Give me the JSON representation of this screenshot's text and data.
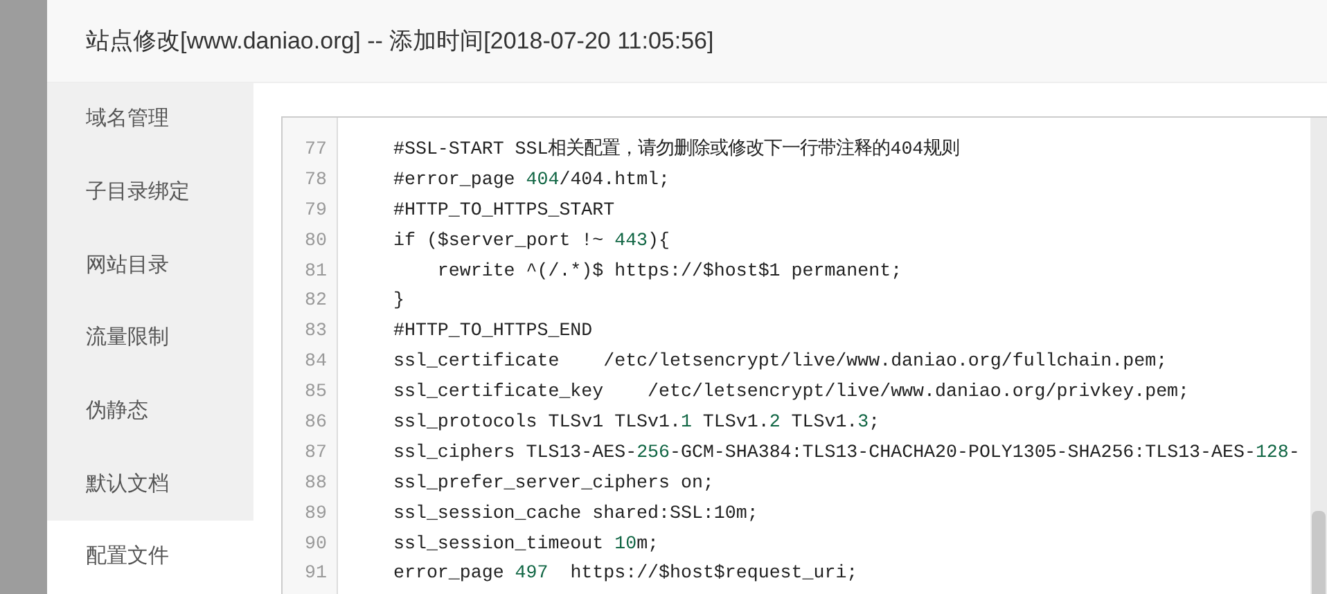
{
  "dialog": {
    "title": "站点修改[www.daniao.org] -- 添加时间[2018-07-20 11:05:56]"
  },
  "sidebar": {
    "items": [
      {
        "label": "域名管理",
        "selected": false
      },
      {
        "label": "子目录绑定",
        "selected": false
      },
      {
        "label": "网站目录",
        "selected": false
      },
      {
        "label": "流量限制",
        "selected": false
      },
      {
        "label": "伪静态",
        "selected": false
      },
      {
        "label": "默认文档",
        "selected": false
      },
      {
        "label": "配置文件",
        "selected": true
      }
    ]
  },
  "editor": {
    "lines": [
      {
        "number": "77",
        "segments": [
          {
            "kind": "plain",
            "text": "#SSL-START SSL相关配置，请勿删除或修改下一行带注释的404规则"
          }
        ]
      },
      {
        "number": "78",
        "segments": [
          {
            "kind": "plain",
            "text": "#error_page "
          },
          {
            "kind": "number",
            "text": "404"
          },
          {
            "kind": "plain",
            "text": "/404.html;"
          }
        ]
      },
      {
        "number": "79",
        "segments": [
          {
            "kind": "plain",
            "text": "#HTTP_TO_HTTPS_START"
          }
        ]
      },
      {
        "number": "80",
        "segments": [
          {
            "kind": "plain",
            "text": "if ($server_port !~ "
          },
          {
            "kind": "number",
            "text": "443"
          },
          {
            "kind": "plain",
            "text": "){"
          }
        ]
      },
      {
        "number": "81",
        "segments": [
          {
            "kind": "plain",
            "text": "    rewrite ^(/.*)$ https://$host$1 permanent;"
          }
        ]
      },
      {
        "number": "82",
        "segments": [
          {
            "kind": "plain",
            "text": "}"
          }
        ]
      },
      {
        "number": "83",
        "segments": [
          {
            "kind": "plain",
            "text": "#HTTP_TO_HTTPS_END"
          }
        ]
      },
      {
        "number": "84",
        "segments": [
          {
            "kind": "plain",
            "text": "ssl_certificate    /etc/letsencrypt/live/www.daniao.org/fullchain.pem;"
          }
        ]
      },
      {
        "number": "85",
        "segments": [
          {
            "kind": "plain",
            "text": "ssl_certificate_key    /etc/letsencrypt/live/www.daniao.org/privkey.pem;"
          }
        ]
      },
      {
        "number": "86",
        "segments": [
          {
            "kind": "plain",
            "text": "ssl_protocols TLSv1 TLSv1."
          },
          {
            "kind": "number",
            "text": "1"
          },
          {
            "kind": "plain",
            "text": " TLSv1."
          },
          {
            "kind": "number",
            "text": "2"
          },
          {
            "kind": "plain",
            "text": " TLSv1."
          },
          {
            "kind": "number",
            "text": "3"
          },
          {
            "kind": "plain",
            "text": ";"
          }
        ]
      },
      {
        "number": "87",
        "segments": [
          {
            "kind": "plain",
            "text": "ssl_ciphers TLS13-AES-"
          },
          {
            "kind": "number",
            "text": "256"
          },
          {
            "kind": "plain",
            "text": "-GCM-SHA384:TLS13-CHACHA20-POLY1305-SHA256:TLS13-AES-"
          },
          {
            "kind": "number",
            "text": "128"
          },
          {
            "kind": "plain",
            "text": "-"
          }
        ]
      },
      {
        "number": "88",
        "segments": [
          {
            "kind": "plain",
            "text": "ssl_prefer_server_ciphers on;"
          }
        ]
      },
      {
        "number": "89",
        "segments": [
          {
            "kind": "plain",
            "text": "ssl_session_cache shared:SSL:10m;"
          }
        ]
      },
      {
        "number": "90",
        "segments": [
          {
            "kind": "plain",
            "text": "ssl_session_timeout "
          },
          {
            "kind": "number",
            "text": "10"
          },
          {
            "kind": "plain",
            "text": "m;"
          }
        ]
      },
      {
        "number": "91",
        "segments": [
          {
            "kind": "plain",
            "text": "error_page "
          },
          {
            "kind": "number",
            "text": "497"
          },
          {
            "kind": "plain",
            "text": "  https://$host$request_uri;"
          }
        ]
      }
    ]
  }
}
